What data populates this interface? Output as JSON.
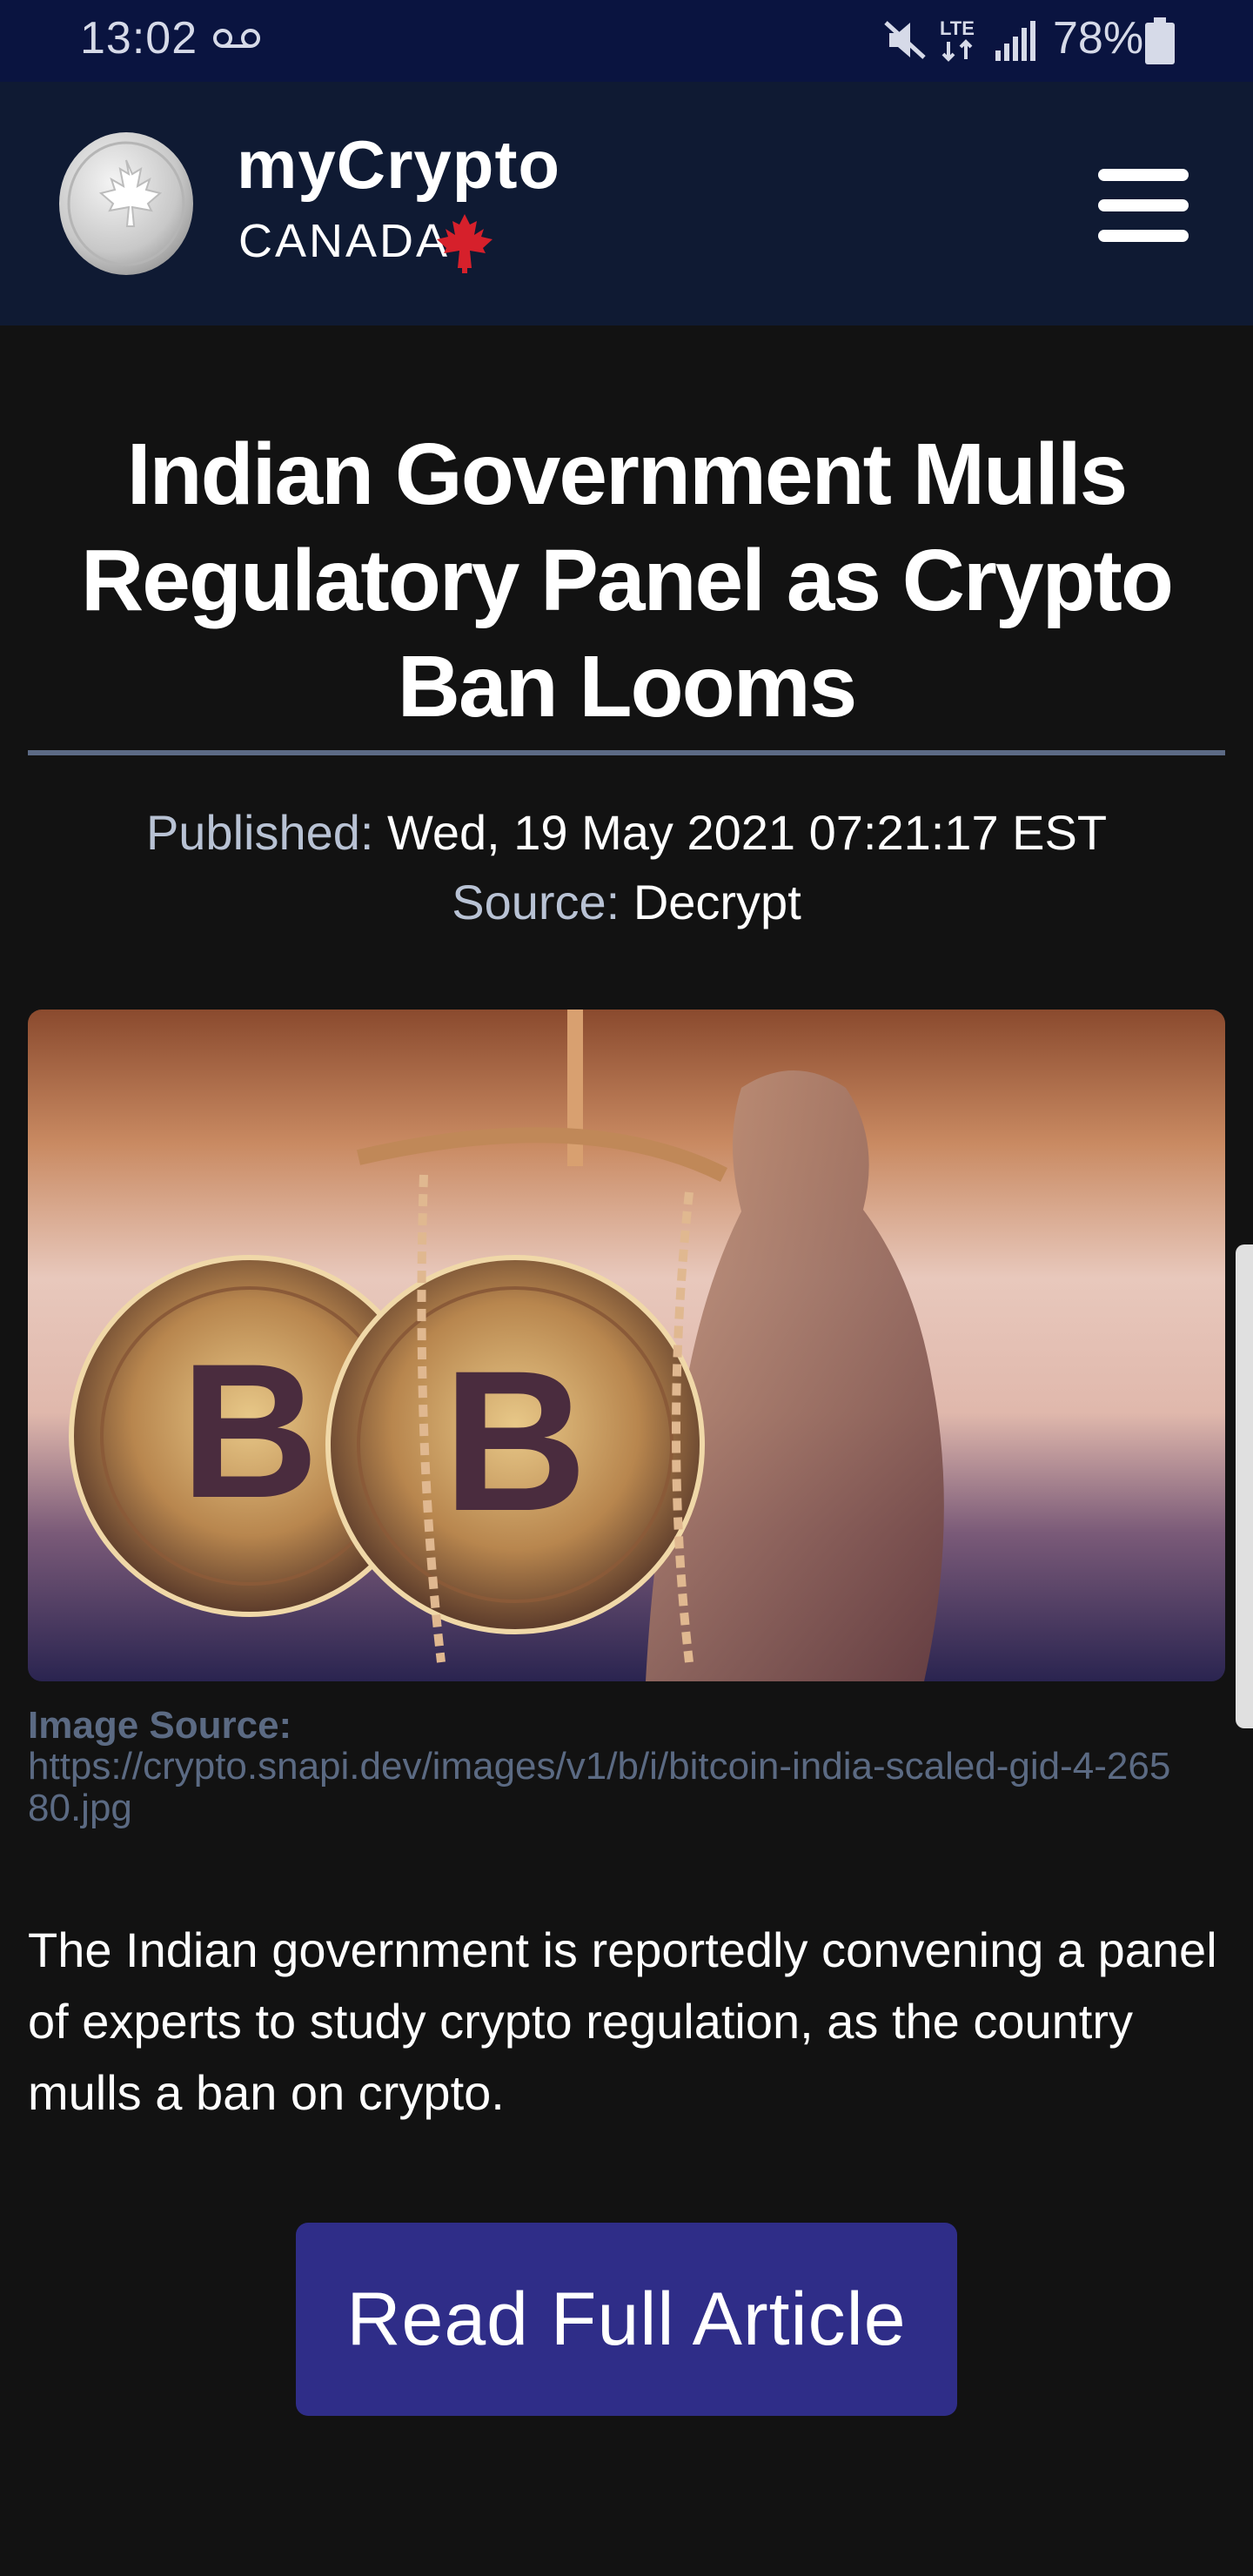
{
  "status_bar": {
    "time": "13:02",
    "network": "LTE",
    "battery_percent": "78%",
    "icons": [
      "voicemail-icon",
      "mute-icon",
      "lte-icon",
      "signal-icon",
      "battery-icon"
    ]
  },
  "header": {
    "brand_title": "myCrypto",
    "brand_subtitle": "CANADA",
    "icons": [
      "maple-leaf-coin-logo",
      "maple-leaf-icon",
      "hamburger-menu-icon"
    ],
    "colors": {
      "background": "#0f1a33",
      "maple_leaf": "#d6202b"
    }
  },
  "article": {
    "title": "Indian Government Mulls Regulatory Panel as Crypto Ban Looms",
    "published_label": "Published:",
    "published_value": "Wed, 19 May 2021 07:21:17 EST",
    "source_label": "Source:",
    "source_value": "Decrypt",
    "image_source_label": "Image Source:",
    "image_source_url": "https://crypto.snapi.dev/images/v1/b/i/bitcoin-india-scaled-gid-4-26580.jpg",
    "summary": "The Indian government is reportedly convening a panel of experts to study crypto regulation, as the country mulls a ban on crypto.",
    "read_button_label": "Read Full Article",
    "colors": {
      "button": "#2f2d88",
      "divider": "#5c6a85",
      "muted_text": "#5b6a83"
    }
  }
}
